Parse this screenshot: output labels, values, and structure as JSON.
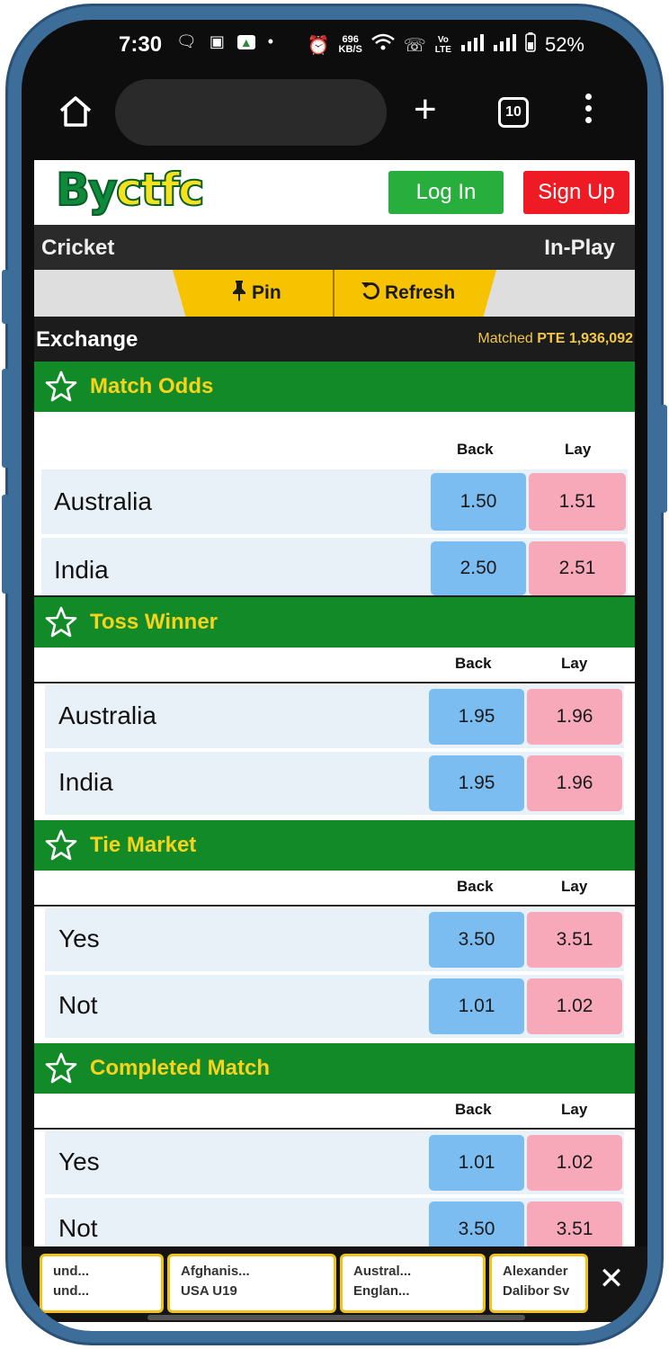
{
  "status_bar": {
    "time": "7:30",
    "net_speed_top": "696",
    "net_speed_bottom": "KB/S",
    "volte_top": "Vo",
    "volte_bottom": "LTE",
    "battery": "52%"
  },
  "browser": {
    "tab_count": "10"
  },
  "header": {
    "logo_part1": "By",
    "logo_part2": "ctfc",
    "login_label": "Log In",
    "signup_label": "Sign Up"
  },
  "sport_bar": {
    "sport": "Cricket",
    "status": "In-Play"
  },
  "actions": {
    "pin_label": "Pin",
    "refresh_label": "Refresh"
  },
  "exchange": {
    "title": "Exchange",
    "matched_label": "Matched",
    "matched_value": "PTE 1,936,092"
  },
  "col_labels": {
    "back": "Back",
    "lay": "Lay"
  },
  "markets": [
    {
      "title": "Match Odds",
      "runners": [
        {
          "name": "Australia",
          "back": "1.50",
          "lay": "1.51"
        },
        {
          "name": "India",
          "back": "2.50",
          "lay": "2.51"
        }
      ]
    },
    {
      "title": "Toss Winner",
      "runners": [
        {
          "name": "Australia",
          "back": "1.95",
          "lay": "1.96"
        },
        {
          "name": "India",
          "back": "1.95",
          "lay": "1.96"
        }
      ]
    },
    {
      "title": "Tie Market",
      "runners": [
        {
          "name": "Yes",
          "back": "3.50",
          "lay": "3.51"
        },
        {
          "name": "Not",
          "back": "1.01",
          "lay": "1.02"
        }
      ]
    },
    {
      "title": "Completed Match",
      "runners": [
        {
          "name": "Yes",
          "back": "1.01",
          "lay": "1.02"
        },
        {
          "name": "Not",
          "back": "3.50",
          "lay": "3.51"
        }
      ]
    }
  ],
  "recent_matches": [
    {
      "line1": "und...",
      "line2": "und..."
    },
    {
      "line1": "Afghanis...",
      "line2": "USA U19"
    },
    {
      "line1": "Austral...",
      "line2": "Englan..."
    },
    {
      "line1": "Alexander",
      "line2": "Dalibor Sv"
    }
  ],
  "colors": {
    "market_header": "#138a28",
    "market_title": "#f7d31a",
    "back": "#7cbdf1",
    "lay": "#f7a9ba",
    "login": "#27ae3c",
    "signup": "#ee1b24"
  }
}
